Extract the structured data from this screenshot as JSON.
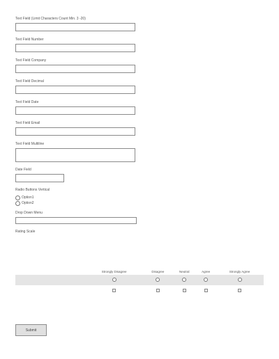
{
  "fields": [
    {
      "label": "Text Field (Limit Characters Count Min. 3 -20)"
    },
    {
      "label": "Text Field Number"
    },
    {
      "label": "Text Field Company"
    },
    {
      "label": "Text Field Decimal"
    },
    {
      "label": "Text Field Date"
    },
    {
      "label": "Text Field Email"
    },
    {
      "label": "Text Field Multiline"
    }
  ],
  "date_field": {
    "label": "Date Field"
  },
  "radio_group": {
    "label": "Radio Buttons Vertical",
    "options": [
      "Option1",
      "Option2"
    ]
  },
  "dropdown": {
    "label": "Drop Down Menu"
  },
  "rating": {
    "label": "Rating Scale",
    "columns": [
      "Strongly Disagree",
      "Disagree",
      "Neutral",
      "Agree",
      "Strongly Agree"
    ]
  },
  "submit_label": "Submit"
}
